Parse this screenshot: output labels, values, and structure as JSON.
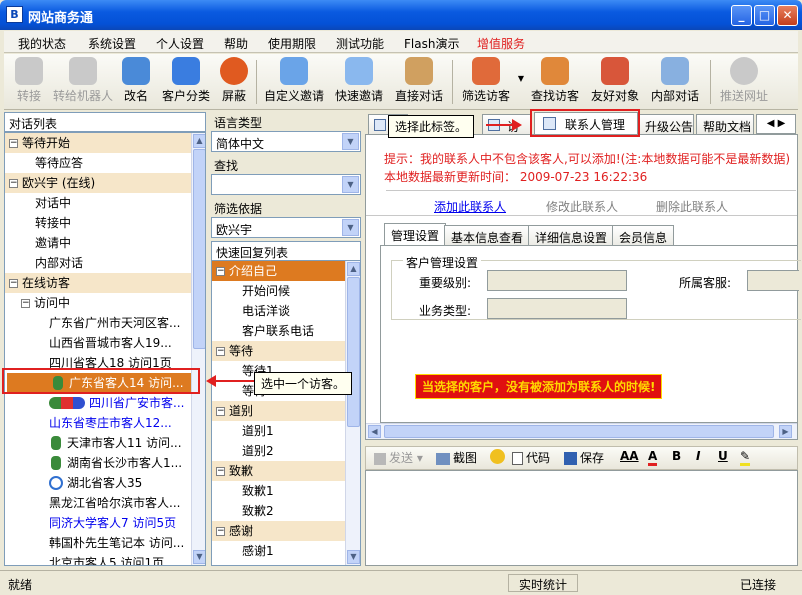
{
  "window": {
    "title": "网站商务通",
    "app_icon": "B"
  },
  "menu": [
    "我的状态",
    "系统设置",
    "个人设置",
    "帮助",
    "使用期限",
    "测试功能",
    "Flash演示",
    "增值服务"
  ],
  "colors": {
    "highlight_menu": "#e02020",
    "selected_row": "#dd7a20",
    "group_bg": "#f6e6c9",
    "notice_red": "#e02020",
    "link_blue": "#0000ee"
  },
  "toolbar": [
    {
      "label": "转接",
      "icon": "transfer-icon",
      "enabled": false
    },
    {
      "label": "转给机器人",
      "icon": "robot-icon",
      "enabled": false
    },
    {
      "label": "改名",
      "icon": "rename-icon",
      "enabled": true
    },
    {
      "label": "客户分类",
      "icon": "customer-category-icon",
      "enabled": true
    },
    {
      "label": "屏蔽",
      "icon": "block-icon",
      "enabled": true
    },
    {
      "label": "自定义邀请",
      "icon": "custom-invite-icon",
      "enabled": true
    },
    {
      "label": "快速邀请",
      "icon": "quick-invite-icon",
      "enabled": true
    },
    {
      "label": "直接对话",
      "icon": "direct-chat-icon",
      "enabled": true
    },
    {
      "label": "筛选访客",
      "icon": "filter-visitor-icon",
      "enabled": true
    },
    {
      "label": "查找访客",
      "icon": "find-visitor-icon",
      "enabled": true
    },
    {
      "label": "友好对象",
      "icon": "friend-icon",
      "enabled": true
    },
    {
      "label": "内部对话",
      "icon": "internal-chat-icon",
      "enabled": true
    },
    {
      "label": "推送网址",
      "icon": "push-url-icon",
      "enabled": false
    }
  ],
  "left_panel": {
    "header": "对话列表",
    "rows": [
      {
        "text": "等待开始",
        "kind": "group",
        "level": 0
      },
      {
        "text": "等待应答",
        "kind": "item",
        "level": 1
      },
      {
        "text": "欧兴宇 (在线)",
        "kind": "group",
        "level": 0
      },
      {
        "text": "对话中",
        "kind": "item",
        "level": 1
      },
      {
        "text": "转接中",
        "kind": "item",
        "level": 1
      },
      {
        "text": "邀请中",
        "kind": "item",
        "level": 1
      },
      {
        "text": "内部对话",
        "kind": "item",
        "level": 1
      },
      {
        "text": "在线访客",
        "kind": "group",
        "level": 0
      },
      {
        "text": "访问中",
        "kind": "subgroup",
        "level": 1
      },
      {
        "text": "广东省广州市天河区客...",
        "kind": "visitor",
        "level": 2
      },
      {
        "text": "山西省晋城市客人19...",
        "kind": "visitor",
        "level": 2
      },
      {
        "text": "四川省客人18 访问1页",
        "kind": "visitor",
        "level": 2
      },
      {
        "text": "广东省客人14 访问...",
        "kind": "selected",
        "level": 2
      },
      {
        "text": "四川省广安市客...",
        "kind": "visitor-blue-multi",
        "level": 2
      },
      {
        "text": "山东省枣庄市客人12...",
        "kind": "visitor-blue",
        "level": 2
      },
      {
        "text": "天津市客人11 访问...",
        "kind": "visitor-icon",
        "level": 2
      },
      {
        "text": "湖南省长沙市客人1...",
        "kind": "visitor-icon",
        "level": 2
      },
      {
        "text": "湖北省客人35",
        "kind": "visitor-search",
        "level": 2
      },
      {
        "text": "黑龙江省哈尔滨市客人...",
        "kind": "visitor",
        "level": 2
      },
      {
        "text": "同济大学客人7 访问5页",
        "kind": "visitor-blue",
        "level": 2
      },
      {
        "text": "韩国朴先生笔记本 访问...",
        "kind": "visitor",
        "level": 2
      },
      {
        "text": "北京市客人5 访问1页",
        "kind": "visitor",
        "level": 2
      }
    ]
  },
  "middle_panel": {
    "language_label": "语言类型",
    "language_value": "简体中文",
    "find_label": "查找",
    "find_value": "",
    "filter_label": "筛选依据",
    "filter_value": "欧兴宇",
    "quick_reply_header": "快速回复列表",
    "rows": [
      {
        "text": "介绍自己",
        "kind": "selected-group"
      },
      {
        "text": "开始问候",
        "kind": "item"
      },
      {
        "text": "电话洋谈",
        "kind": "item"
      },
      {
        "text": "客户联系电话",
        "kind": "item"
      },
      {
        "text": "等待",
        "kind": "group"
      },
      {
        "text": "等待1",
        "kind": "item"
      },
      {
        "text": "等待2",
        "kind": "item"
      },
      {
        "text": "道别",
        "kind": "group"
      },
      {
        "text": "道别1",
        "kind": "item"
      },
      {
        "text": "道别2",
        "kind": "item"
      },
      {
        "text": "致歉",
        "kind": "group"
      },
      {
        "text": "致歉1",
        "kind": "item"
      },
      {
        "text": "致歉2",
        "kind": "item"
      },
      {
        "text": "感谢",
        "kind": "group"
      },
      {
        "text": "感谢1",
        "kind": "item"
      }
    ]
  },
  "right_panel": {
    "top_tabs": [
      "访",
      "联系人管理",
      "升级公告",
      "帮助文档"
    ],
    "notice_line1": "提示：我的联系人中不包含该客人,可以添加!(注:本地数据可能不是最新数据)",
    "notice_line2": "本地数据最新更新时间：  2009-07-23    16:22:36",
    "actions": {
      "add": "添加此联系人",
      "edit": "修改此联系人",
      "delete": "删除此联系人"
    },
    "inner_tabs": [
      "管理设置",
      "基本信息查看",
      "详细信息设置",
      "会员信息"
    ],
    "fieldset_title": "客户管理设置",
    "fields": {
      "importance": "重要级别:",
      "owner": "所属客服:",
      "business": "业务类型:"
    },
    "banner": "当选择的客户，没有被添加为联系人的时候!"
  },
  "editor_toolbar": {
    "send": "发送",
    "screenshot": "截图",
    "code": "代码",
    "save": "保存",
    "bold": "B",
    "italic": "I",
    "underline": "U"
  },
  "callouts": {
    "tab_hint": "选择此标签。",
    "visitor_hint": "选中一个访客。"
  },
  "status": {
    "left": "就绪",
    "mid": "实时统计",
    "right": "已连接"
  }
}
